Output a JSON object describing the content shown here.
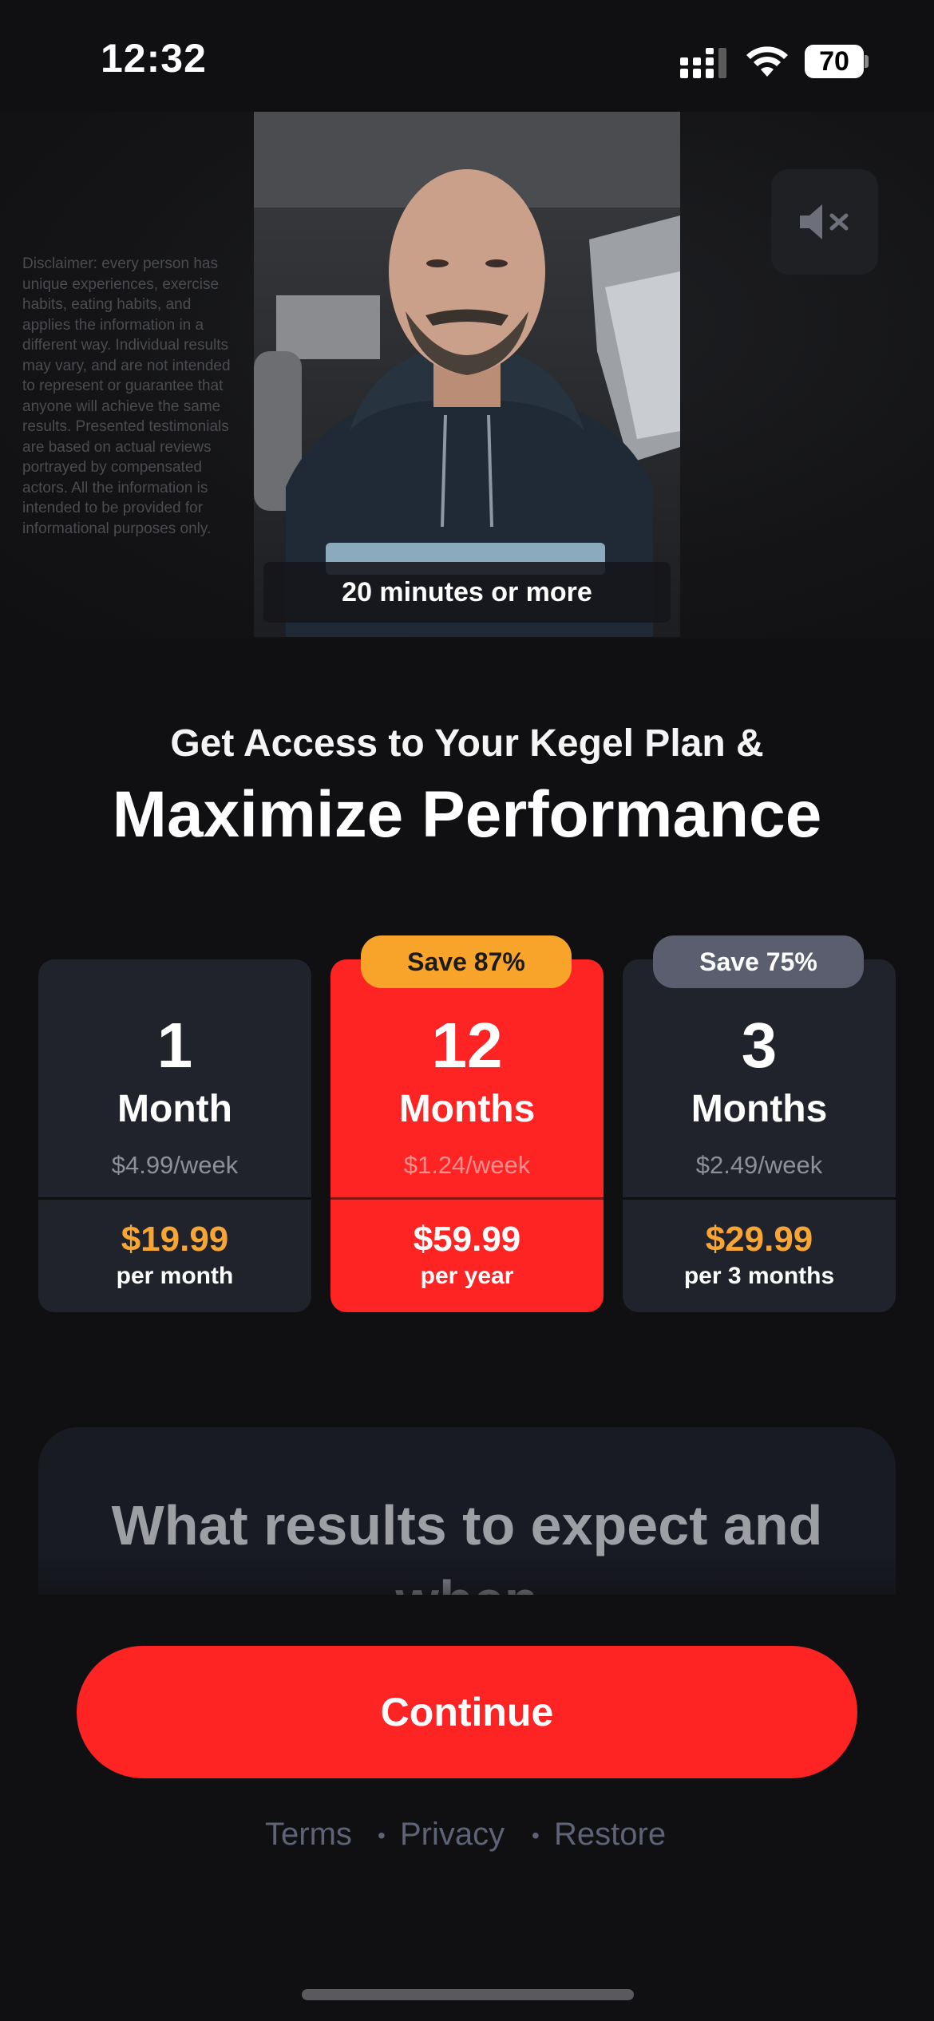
{
  "status_bar": {
    "time": "12:32",
    "battery_level": "70",
    "icons": [
      "signal-icon",
      "wifi-icon",
      "battery-icon"
    ]
  },
  "hero": {
    "disclaimer": "Disclaimer: every person has unique experiences, exercise habits, eating habits, and applies the information in a different way. Individual results may vary, and are not intended to represent or guarantee that anyone will achieve the same results. Presented testimonials are based on actual reviews portrayed by compensated actors. All the information is intended to be provided for informational purposes only.",
    "video_caption": "20 minutes or more",
    "mute_icon": "speaker-muted-icon"
  },
  "headline": {
    "subtitle": "Get Access to Your Kegel Plan &",
    "title": "Maximize Performance"
  },
  "plans": [
    {
      "count": "1",
      "unit": "Month",
      "weekly": "$4.99/week",
      "price": "$19.99",
      "period": "per month",
      "badge": "",
      "selected": false
    },
    {
      "count": "12",
      "unit": "Months",
      "weekly": "$1.24/week",
      "price": "$59.99",
      "period": "per year",
      "badge": "Save 87%",
      "selected": true
    },
    {
      "count": "3",
      "unit": "Months",
      "weekly": "$2.49/week",
      "price": "$29.99",
      "period": "per 3 months",
      "badge": "Save 75%",
      "selected": false
    }
  ],
  "results": {
    "title": "What results to expect and when"
  },
  "continue_label": "Continue",
  "footer": {
    "terms": "Terms",
    "privacy": "Privacy",
    "restore": "Restore",
    "separator": "•"
  },
  "colors": {
    "accent_red": "#fe2424",
    "price_orange": "#f7a636",
    "badge_orange": "#f8a42b",
    "card_bg": "#20232b",
    "background": "#101012"
  }
}
